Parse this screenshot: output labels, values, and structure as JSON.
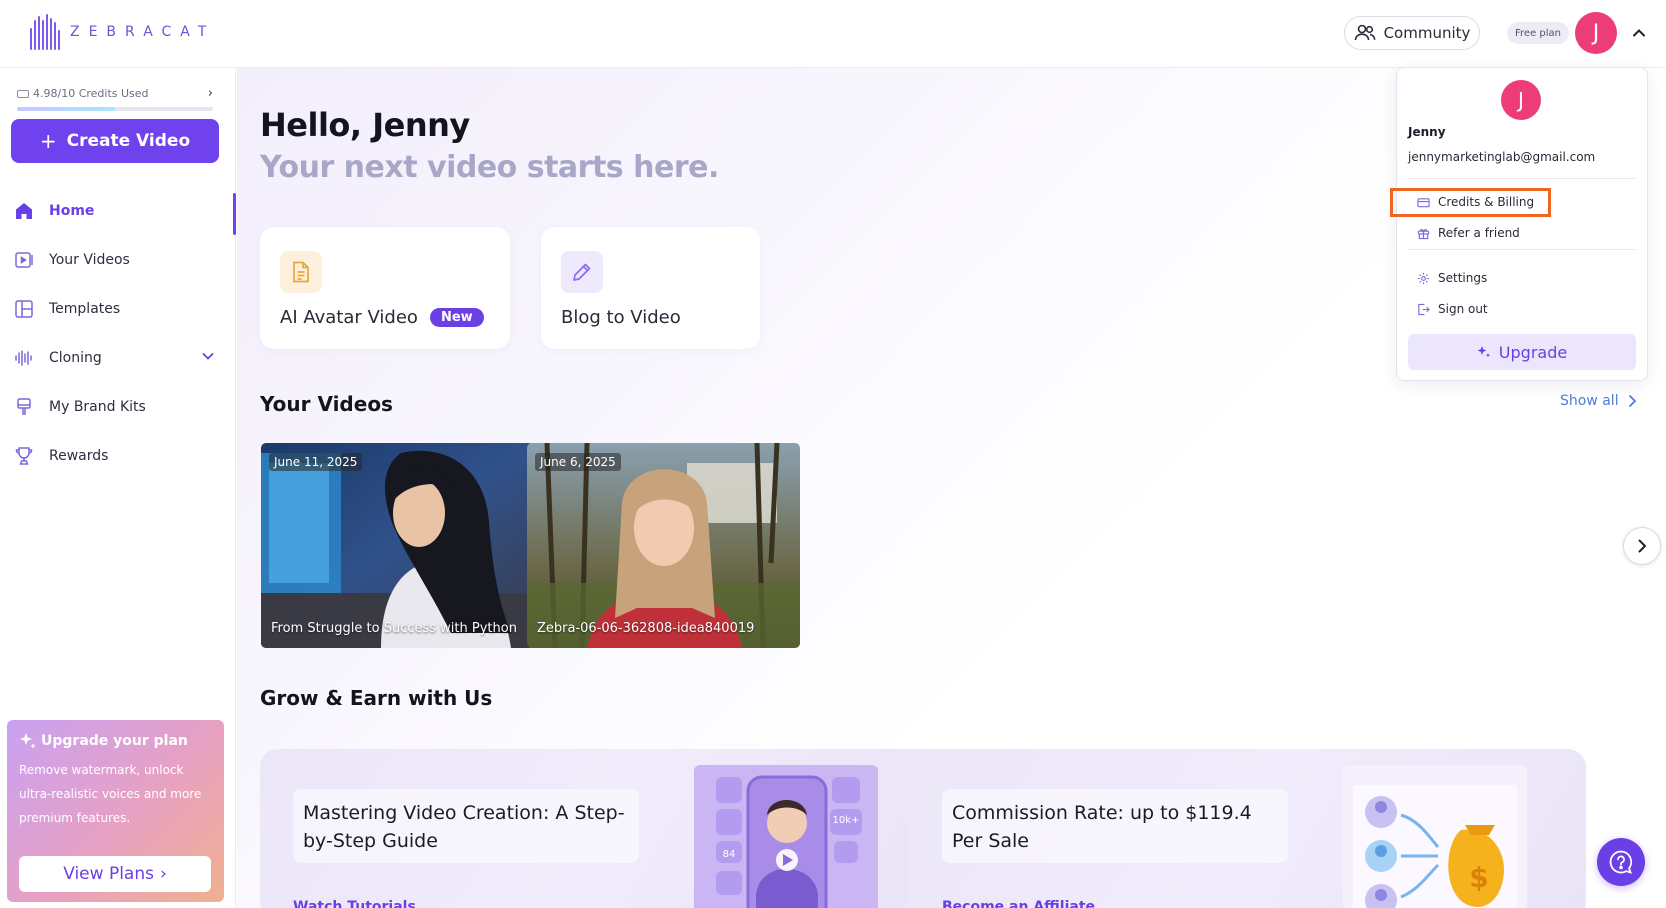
{
  "brand": {
    "name": "ZEBRACAT",
    "accent": "#7042ee"
  },
  "topbar": {
    "community_label": "Community",
    "plan_badge": "Free plan",
    "avatar_initial": "J"
  },
  "sidebar": {
    "credits_label": "4.98/10 Credits Used",
    "credits_fraction": 0.498,
    "create_label": "Create Video",
    "items": [
      {
        "label": "Home",
        "icon": "home-icon",
        "active": true
      },
      {
        "label": "Your Videos",
        "icon": "video-icon"
      },
      {
        "label": "Templates",
        "icon": "templates-icon"
      },
      {
        "label": "Cloning",
        "icon": "waveform-icon",
        "expandable": true
      },
      {
        "label": "My Brand Kits",
        "icon": "brand-kit-icon"
      },
      {
        "label": "Rewards",
        "icon": "trophy-icon"
      }
    ],
    "upgrade_card": {
      "title": "Upgrade your plan",
      "description": "Remove watermark, unlock ultra-realistic voices and more premium features.",
      "button_label": "View Plans"
    }
  },
  "main": {
    "greeting": "Hello, Jenny",
    "tagline": "Your next video starts here.",
    "tools": [
      {
        "label": "AI Avatar Video",
        "badge": "New",
        "icon": "document-icon"
      },
      {
        "label": "Blog to Video",
        "icon": "pencil-icon"
      }
    ],
    "your_videos_title": "Your Videos",
    "show_all_label": "Show all",
    "videos": [
      {
        "date": "June 11, 2025",
        "title": "From Struggle to Success with Python"
      },
      {
        "date": "June 6, 2025",
        "title": "Zebra-06-06-362808-idea840019"
      }
    ],
    "grow_title": "Grow & Earn with Us",
    "promos": [
      {
        "text": "Mastering Video Creation: A Step-by-Step Guide",
        "link": "Watch Tutorials",
        "img_badges": [
          "84",
          "10k+"
        ]
      },
      {
        "text": "Commission Rate: up to $119.4 Per Sale",
        "link": "Become an Affiliate"
      }
    ]
  },
  "dropdown": {
    "avatar_initial": "J",
    "name": "Jenny",
    "email": "jennymarketinglab@gmail.com",
    "items": [
      {
        "label": "Credits & Billing",
        "icon": "credit-card-icon",
        "highlighted": true
      },
      {
        "label": "Refer a friend",
        "icon": "gift-icon"
      },
      {
        "label": "Settings",
        "icon": "gear-icon"
      },
      {
        "label": "Sign out",
        "icon": "sign-out-icon"
      }
    ],
    "upgrade_label": "Upgrade",
    "highlight_color": "#f06620"
  }
}
